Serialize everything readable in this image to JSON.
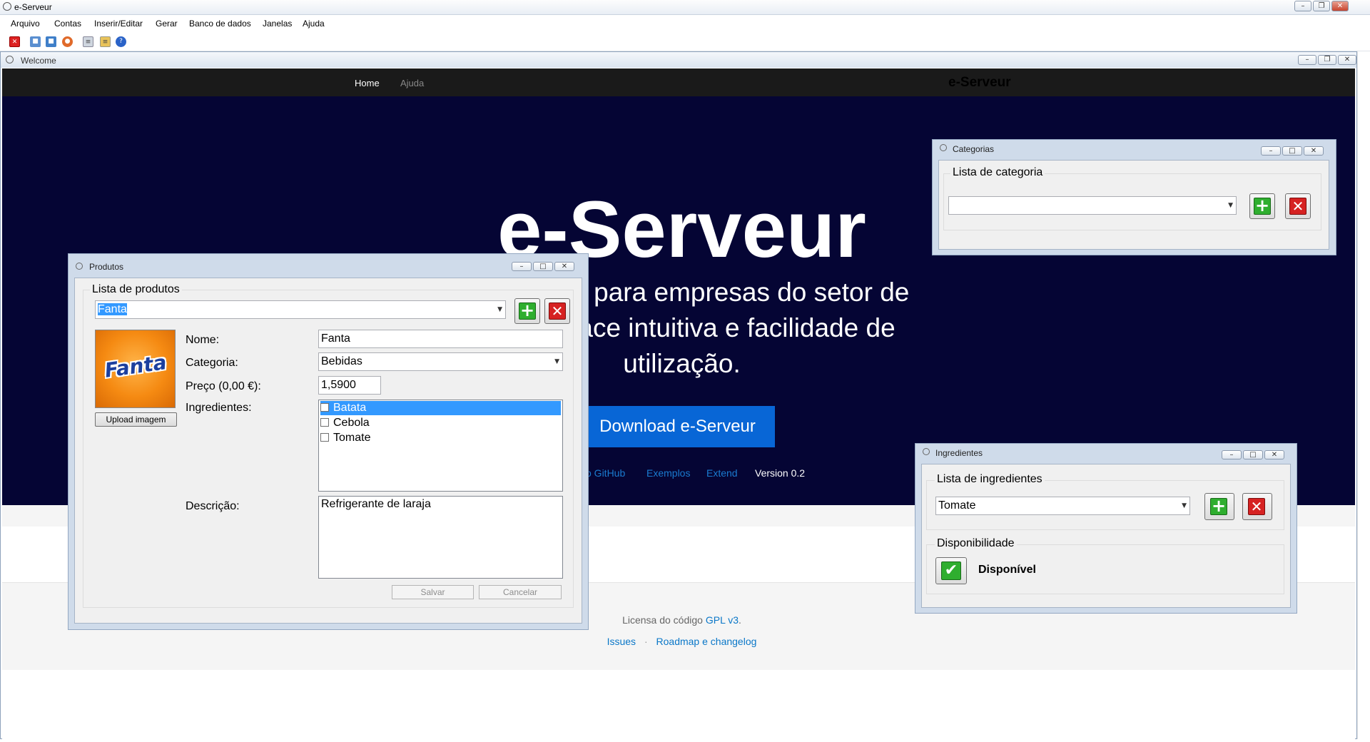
{
  "app": {
    "title": "e-Serveur"
  },
  "menu": [
    "Arquivo",
    "Contas",
    "Inserir/Editar",
    "Gerar",
    "Banco de dados",
    "Janelas",
    "Ajuda"
  ],
  "mdi": {
    "title": "Welcome"
  },
  "site": {
    "nav_home": "Home",
    "nav_ajuda": "Ajuda",
    "brand": "e-Serveur",
    "hero_title": "e-Serveur",
    "hero_line1": "ação para empresas do setor de",
    "hero_line2": "nterface intuitiva e facilidade de",
    "hero_line3": "utilização.",
    "download": "Download e-Serveur",
    "link_github": "o GitHub",
    "link_exemplos": "Exemplos",
    "link_extend": "Extend",
    "version": "Version 0.2",
    "license_prefix": "Licensa do código ",
    "license_link": "GPL v3",
    "license_suffix": ".",
    "footer_issues": "Issues",
    "footer_sep": "·",
    "footer_roadmap": "Roadmap e changelog"
  },
  "produtos": {
    "title": "Produtos",
    "group": "Lista de produtos",
    "selected": "Fanta",
    "logo_text": "Fanta",
    "upload": "Upload imagem",
    "nome_label": "Nome:",
    "nome": "Fanta",
    "categoria_label": "Categoria:",
    "categoria": "Bebidas",
    "preco_label": "Preço (0,00 €):",
    "preco": "1,5900",
    "ingredientes_label": "Ingredientes:",
    "ingredientes": [
      {
        "name": "Batata",
        "selected": true
      },
      {
        "name": "Cebola",
        "selected": false
      },
      {
        "name": "Tomate",
        "selected": false
      }
    ],
    "descricao_label": "Descrição:",
    "descricao": "Refrigerante de laraja",
    "salvar": "Salvar",
    "cancelar": "Cancelar"
  },
  "categorias": {
    "title": "Categorias",
    "group": "Lista de categoria",
    "selected": ""
  },
  "ingredientes_win": {
    "title": "Ingredientes",
    "group": "Lista de ingredientes",
    "selected": "Tomate",
    "disp_group": "Disponibilidade",
    "disp_status": "Disponível"
  },
  "colors": {
    "hero_bg": "#050534",
    "download_btn": "#0866d6",
    "link": "#0a77c8",
    "navbar": "#1a1a1a"
  }
}
